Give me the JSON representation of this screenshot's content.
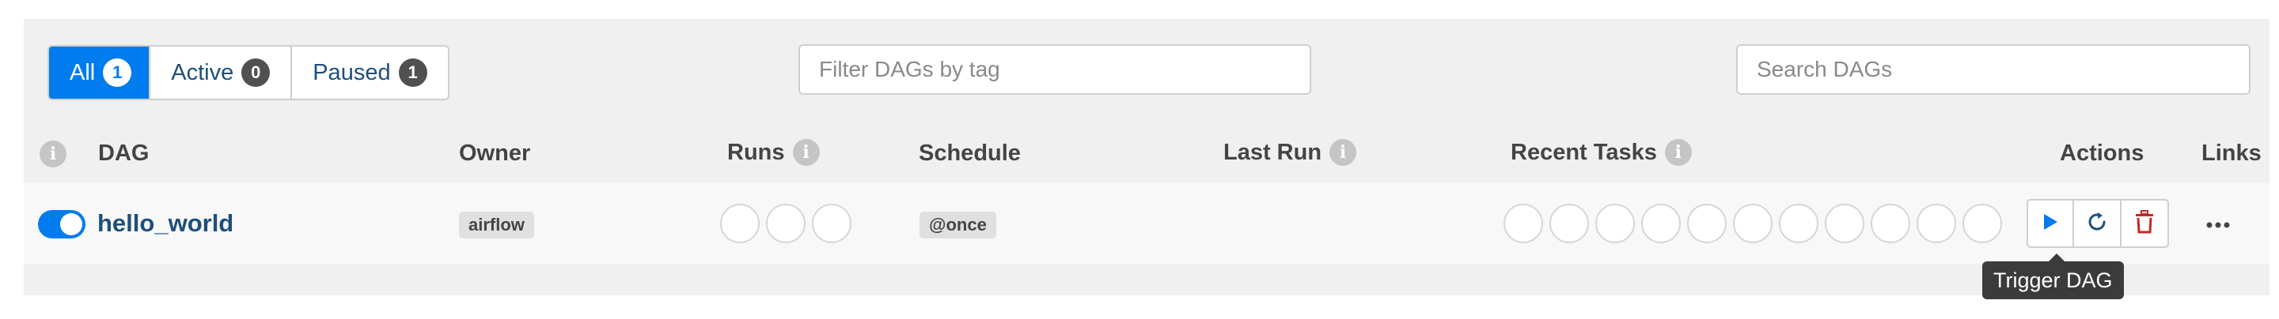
{
  "filters": {
    "status_tabs": [
      {
        "label": "All",
        "count": "1",
        "active": true
      },
      {
        "label": "Active",
        "count": "0",
        "active": false
      },
      {
        "label": "Paused",
        "count": "1",
        "active": false
      }
    ],
    "tag_filter_placeholder": "Filter DAGs by tag",
    "search_placeholder": "Search DAGs"
  },
  "table": {
    "headers": {
      "dag": "DAG",
      "owner": "Owner",
      "runs": "Runs",
      "schedule": "Schedule",
      "last_run": "Last Run",
      "recent_tasks": "Recent Tasks",
      "actions": "Actions",
      "links": "Links"
    },
    "info_icon_glyph": "i",
    "rows": [
      {
        "paused": false,
        "dag_id": "hello_world",
        "owner": "airflow",
        "run_states_count": 3,
        "schedule": "@once",
        "last_run": "",
        "task_states_count": 11
      }
    ]
  },
  "actions": {
    "trigger_icon": "play-icon",
    "refresh_icon": "refresh-icon",
    "delete_icon": "trash-icon",
    "links_icon": "ellipsis-icon"
  },
  "tooltip": "Trigger DAG",
  "colors": {
    "accent": "#017cee",
    "link": "#1e4f7c",
    "delete": "#c62828",
    "badge": "#51504f"
  }
}
